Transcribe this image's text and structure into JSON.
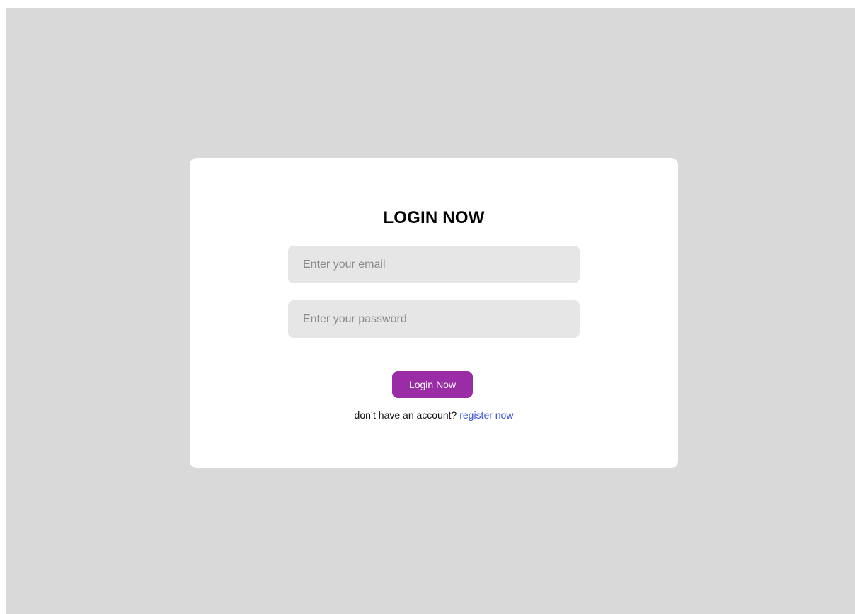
{
  "login": {
    "title": "LOGIN NOW",
    "email_placeholder": "Enter your email",
    "password_placeholder": "Enter your password",
    "submit_label": "Login Now",
    "register_prompt": "don’t have an account?",
    "register_link": "register now"
  },
  "colors": {
    "page_background": "#d9d9d9",
    "card_background": "#ffffff",
    "input_background": "#e6e6e6",
    "button_accent": "#9a2ca6",
    "link": "#3b55d9"
  }
}
